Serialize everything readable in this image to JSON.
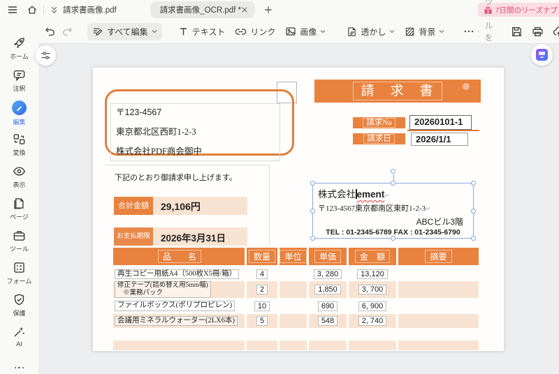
{
  "titlebar": {
    "tab_inactive": "請求書画像.pdf",
    "tab_active": "請求書画像_OCR.pdf *",
    "trial_badge": "7日間のリーズナブ"
  },
  "toolbar": {
    "edit_all": "すべて編集",
    "text": "テキスト",
    "link": "リンク",
    "image": "画像",
    "watermark": "透かし",
    "background": "背景",
    "search_placeholder": "ツールを検索"
  },
  "sidebar": {
    "items": [
      {
        "label": "ホーム",
        "icon": "rocket-icon"
      },
      {
        "label": "注釈",
        "icon": "comment-icon"
      },
      {
        "label": "編集",
        "icon": "edit-pencil-icon",
        "active": true
      },
      {
        "label": "変換",
        "icon": "convert-icon"
      },
      {
        "label": "表示",
        "icon": "eye-icon"
      },
      {
        "label": "ページ",
        "icon": "pages-icon"
      },
      {
        "label": "ツール",
        "icon": "toolbox-icon"
      },
      {
        "label": "フォーム",
        "icon": "form-icon"
      },
      {
        "label": "保護",
        "icon": "shield-icon"
      },
      {
        "label": "AI",
        "icon": "magic-wand-icon"
      }
    ]
  },
  "doc": {
    "recipient_postal": "〒123-4567",
    "recipient_address": "東京都北区西町1-2-3",
    "recipient_company": "株式会社PDF商会御中",
    "title": "請　求　書",
    "invoice_no_label": "請求Na",
    "invoice_no": "20260101-1",
    "invoice_date_label": "請求日",
    "invoice_date": "2026/1/1",
    "greeting": "下記のとおり御請求申し上げます。",
    "total_label": "合計金額",
    "total_value": "29,106円",
    "due_label": "お支払期限",
    "due_value": "2026年3月31日",
    "sender_company_prefix": "株式会社",
    "sender_company_edit": "ement",
    "return_mark": "↵",
    "sender_address": "〒123-4567東京都南区東町1-2-3",
    "sender_building": "ABCビル3階",
    "sender_tel": "TEL : 01-2345-6789 FAX : 01-2345-6790",
    "table": {
      "headers": [
        "品　　名",
        "数量",
        "単位",
        "単価",
        "金　額",
        "摘要"
      ],
      "rows": [
        {
          "name": "再生コピー用紙A4（500枚X5冊/箱）",
          "name2": "",
          "qty": "4",
          "unit": "",
          "price": "3, 280",
          "amount": "13,120",
          "note": ""
        },
        {
          "name": "修正テープ(詰め替え用5mm幅)",
          "name2": "※業務パック",
          "qty": "2",
          "unit": "",
          "price": "1,850",
          "amount": "3, 700",
          "note": ""
        },
        {
          "name": "ファイルボックス(ポリプロピレン)",
          "name2": "",
          "qty": "10",
          "unit": "",
          "price": "690",
          "amount": "6, 900",
          "note": ""
        },
        {
          "name": "会議用ミネラルウォーター(2LX6本)",
          "name2": "",
          "qty": "5",
          "unit": "",
          "price": "548",
          "amount": "2, 740",
          "note": ""
        }
      ]
    }
  },
  "colors": {
    "accent_orange": "#E8823E",
    "row_peach": "#F8E3D2",
    "badge_pink_bg": "#FBDDE2",
    "badge_pink_text": "#E8447A",
    "active_blue": "#3B78E7",
    "selection_blue": "#88A9DE",
    "chrome_bg": "#F9F9F7",
    "canvas_bg": "#EDEEF0"
  }
}
